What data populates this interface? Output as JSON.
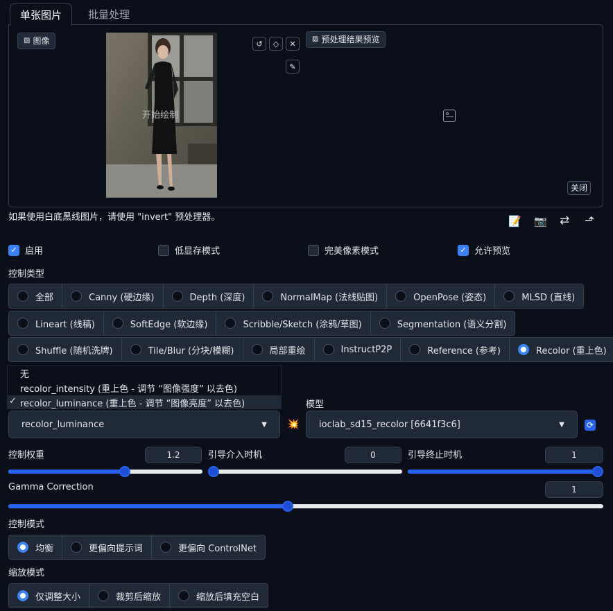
{
  "tabs": [
    {
      "label": "单张图片"
    },
    {
      "label": "批量处理"
    }
  ],
  "image_panel": {
    "image_label": "图像",
    "preview_label": "预处理结果预览",
    "overlay_text": "开始绘制",
    "close_label": "关闭"
  },
  "hint": "如果使用白底黑线图片，请使用 \"invert\" 预处理器。",
  "toolbar_icons": [
    "edit-icon",
    "camera-icon",
    "swap-icon",
    "send-icon"
  ],
  "checkboxes": [
    {
      "label": "启用",
      "checked": true
    },
    {
      "label": "低显存模式",
      "checked": false
    },
    {
      "label": "完美像素模式",
      "checked": false
    },
    {
      "label": "允许预览",
      "checked": true
    }
  ],
  "control_type": {
    "label": "控制类型",
    "rows": [
      [
        {
          "label": "全部"
        },
        {
          "label": "Canny (硬边缘)"
        },
        {
          "label": "Depth (深度)"
        },
        {
          "label": "NormalMap (法线贴图)"
        },
        {
          "label": "OpenPose (姿态)"
        },
        {
          "label": "MLSD (直线)"
        }
      ],
      [
        {
          "label": "Lineart (线稿)"
        },
        {
          "label": "SoftEdge (软边缘)"
        },
        {
          "label": "Scribble/Sketch (涂鸦/草图)"
        },
        {
          "label": "Segmentation (语义分割)"
        }
      ],
      [
        {
          "label": "Shuffle (随机洗牌)"
        },
        {
          "label": "Tile/Blur (分块/模糊)"
        },
        {
          "label": "局部重绘"
        },
        {
          "label": "InstructP2P"
        },
        {
          "label": "Reference (参考)"
        },
        {
          "label": "Recolor (重上色)",
          "selected": true
        }
      ]
    ]
  },
  "preprocessor_menu": [
    {
      "label": "无",
      "checked": false
    },
    {
      "label": "recolor_intensity (重上色 - 调节 “图像强度” 以去色)",
      "checked": false
    },
    {
      "label": "recolor_luminance (重上色 - 调节 “图像亮度” 以去色)",
      "checked": true
    }
  ],
  "preprocessor": {
    "value": "recolor_luminance"
  },
  "model": {
    "label": "模型",
    "value": "ioclab_sd15_recolor [6641f3c6]"
  },
  "sliders": {
    "weight": {
      "label": "控制权重",
      "value": "1.2",
      "fraction": 0.6
    },
    "start": {
      "label": "引导介入时机",
      "value": "0",
      "fraction": 0.0
    },
    "end": {
      "label": "引导终止时机",
      "value": "1",
      "fraction": 1.0
    },
    "gamma": {
      "label": "Gamma Correction",
      "value": "1",
      "fraction": 0.47
    }
  },
  "control_mode": {
    "label": "控制模式",
    "options": [
      {
        "label": "均衡",
        "selected": true
      },
      {
        "label": "更偏向提示词"
      },
      {
        "label": "更偏向 ControlNet"
      }
    ]
  },
  "resize_mode": {
    "label": "缩放模式",
    "options": [
      {
        "label": "仅调整大小",
        "selected": true
      },
      {
        "label": "裁剪后缩放"
      },
      {
        "label": "缩放后填充空白"
      }
    ]
  }
}
